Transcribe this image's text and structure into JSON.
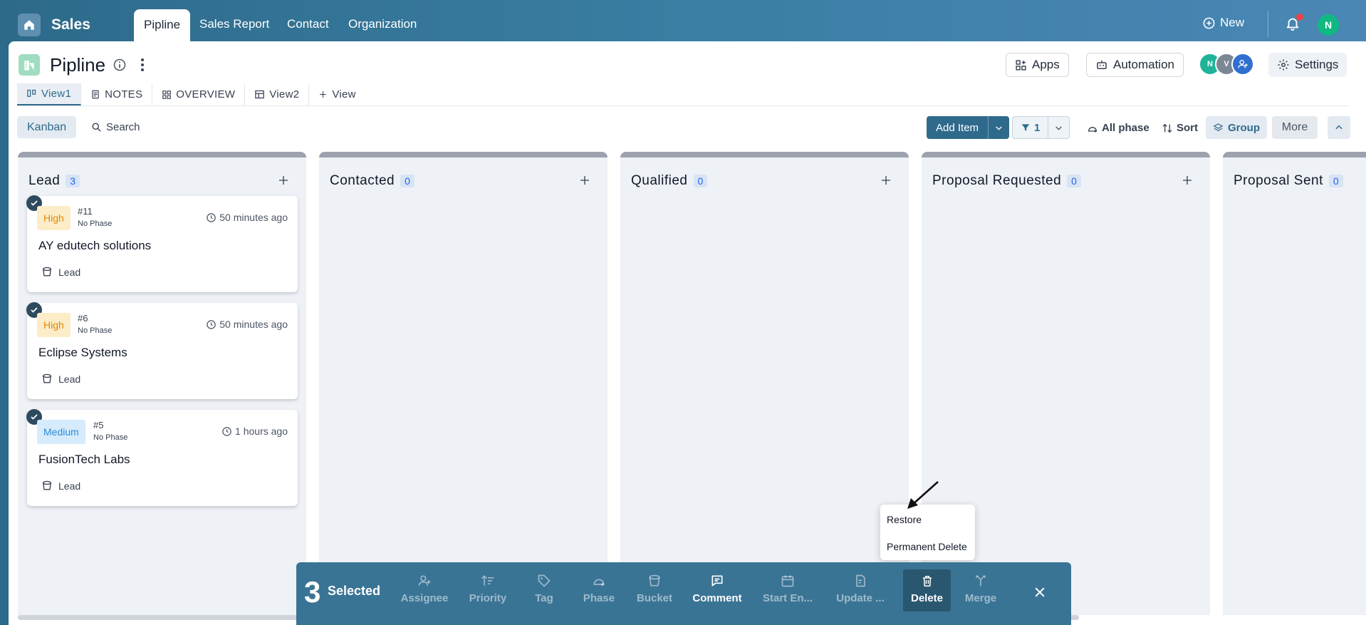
{
  "app": {
    "title": "Sales",
    "tabs": [
      {
        "label": "Pipline",
        "active": true
      },
      {
        "label": "Sales Report"
      },
      {
        "label": "Contact"
      },
      {
        "label": "Organization"
      }
    ],
    "new_label": "New",
    "user_initial": "N",
    "icons": {
      "home": "home-icon",
      "new": "plus-circle-icon",
      "notifications": "bell-icon"
    }
  },
  "page": {
    "title": "Pipline",
    "buttons": {
      "apps": "Apps",
      "automation": "Automation",
      "settings": "Settings"
    },
    "members": [
      {
        "initial": "N",
        "color": "#1fb39a"
      },
      {
        "initial": "V",
        "color": "#7b8794"
      }
    ]
  },
  "views": [
    {
      "label": "View1",
      "icon": "kanban-view-icon",
      "active": true
    },
    {
      "label": "NOTES",
      "icon": "notes-icon"
    },
    {
      "label": "OVERVIEW",
      "icon": "overview-icon"
    },
    {
      "label": "View2",
      "icon": "table-icon"
    },
    {
      "label": "View",
      "icon": "plus-icon"
    }
  ],
  "toolbar": {
    "kanban": "Kanban",
    "search": "Search",
    "add_item": "Add Item",
    "filter_count": "1",
    "all_phase": "All phase",
    "sort": "Sort",
    "group": "Group",
    "more": "More"
  },
  "columns": [
    {
      "name": "Lead",
      "count": "3",
      "cards": [
        {
          "priority": "High",
          "number": "#11",
          "phase": "No Phase",
          "time": "50 minutes ago",
          "title": "AY edutech solutions",
          "bucket": "Lead"
        },
        {
          "priority": "High",
          "number": "#6",
          "phase": "No Phase",
          "time": "50 minutes ago",
          "title": "Eclipse Systems",
          "bucket": "Lead"
        },
        {
          "priority": "Medium",
          "number": "#5",
          "phase": "No Phase",
          "time": "1 hours ago",
          "title": "FusionTech Labs",
          "bucket": "Lead"
        }
      ]
    },
    {
      "name": "Contacted",
      "count": "0",
      "cards": []
    },
    {
      "name": "Qualified",
      "count": "0",
      "cards": []
    },
    {
      "name": "Proposal Requested",
      "count": "0",
      "cards": []
    },
    {
      "name": "Proposal Sent",
      "count": "0",
      "cards": []
    }
  ],
  "context_menu": {
    "items": [
      "Restore",
      "Permanent Delete"
    ]
  },
  "bulk_bar": {
    "count": "3",
    "label": "Selected",
    "actions": [
      {
        "label": "Assignee",
        "icon": "add-user-icon"
      },
      {
        "label": "Priority",
        "icon": "priority-icon"
      },
      {
        "label": "Tag",
        "icon": "tag-icon"
      },
      {
        "label": "Phase",
        "icon": "phase-icon"
      },
      {
        "label": "Bucket",
        "icon": "bucket-icon"
      },
      {
        "label": "Comment",
        "icon": "comment-icon"
      },
      {
        "label": "Start En...",
        "icon": "calendar-icon"
      },
      {
        "label": "Update ...",
        "icon": "update-icon"
      },
      {
        "label": "Delete",
        "icon": "trash-icon"
      },
      {
        "label": "Merge",
        "icon": "merge-icon"
      }
    ]
  },
  "colors": {
    "accent": "#2f6a8c",
    "high": "#e08a00",
    "medium": "#2d8ad6",
    "count": "#2563eb"
  }
}
